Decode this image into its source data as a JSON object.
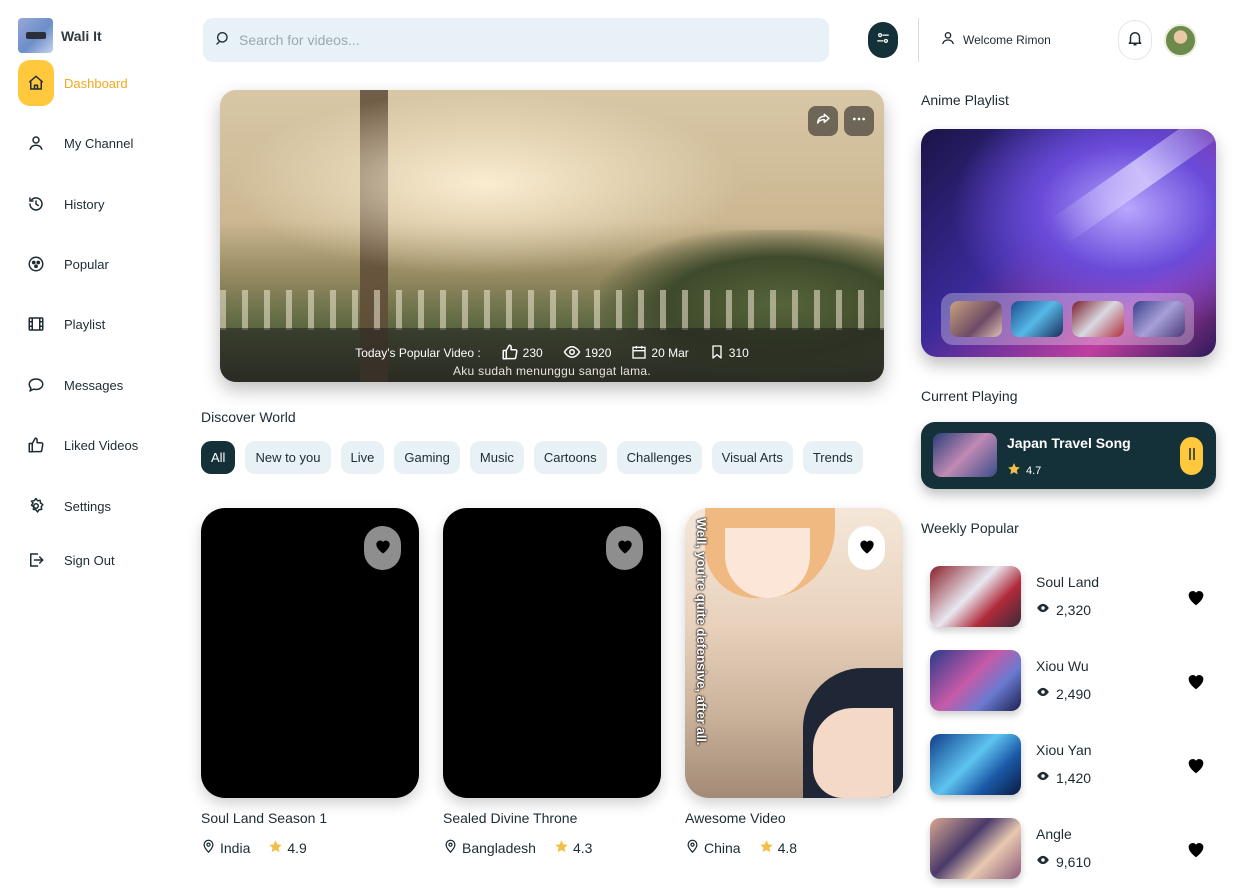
{
  "brand": {
    "name": "Wali It"
  },
  "sidebar": {
    "items": [
      {
        "label": "Dashboard",
        "icon": "home-icon",
        "active": true
      },
      {
        "label": "My Channel",
        "icon": "user-icon"
      },
      {
        "label": "History",
        "icon": "history-icon"
      },
      {
        "label": "Popular",
        "icon": "popular-icon"
      },
      {
        "label": "Playlist",
        "icon": "film-icon"
      },
      {
        "label": "Messages",
        "icon": "message-icon"
      },
      {
        "label": "Liked Videos",
        "icon": "thumbs-up-icon"
      },
      {
        "label": "Settings",
        "icon": "gear-icon"
      },
      {
        "label": "Sign Out",
        "icon": "sign-out-icon"
      }
    ]
  },
  "search": {
    "placeholder": "Search for videos..."
  },
  "header": {
    "welcome": "Welcome Rimon"
  },
  "hero": {
    "label": "Today's Popular Video :",
    "likes": "230",
    "views": "1920",
    "date": "20 Mar",
    "saves": "310",
    "subtitle": "Aku sudah menunggu sangat lama."
  },
  "discover": {
    "title": "Discover World",
    "chips": [
      "All",
      "New to you",
      "Live",
      "Gaming",
      "Music",
      "Cartoons",
      "Challenges",
      "Visual Arts",
      "Trends"
    ],
    "active_chip": "All"
  },
  "videos": [
    {
      "title": "Soul Land Season 1",
      "location": "India",
      "rating": "4.9"
    },
    {
      "title": "Sealed Divine Throne",
      "location": "Bangladesh",
      "rating": "4.3"
    },
    {
      "title": "Awesome Video",
      "location": "China",
      "rating": "4.8",
      "caption": "Well, you're quite defensive, after all."
    }
  ],
  "anime_playlist": {
    "title": "Anime Playlist"
  },
  "current_playing": {
    "title": "Current Playing",
    "song": "Japan Travel Song",
    "rating": "4.7"
  },
  "weekly": {
    "title": "Weekly Popular",
    "items": [
      {
        "name": "Soul Land",
        "views": "2,320"
      },
      {
        "name": "Xiou Wu",
        "views": "2,490"
      },
      {
        "name": "Xiou Yan",
        "views": "1,420"
      },
      {
        "name": "Angle",
        "views": "9,610"
      }
    ]
  },
  "colors": {
    "accent": "#ffc83d",
    "dark": "#143139",
    "chip_bg": "#e8f1f5",
    "active_text": "#f2a91c"
  }
}
